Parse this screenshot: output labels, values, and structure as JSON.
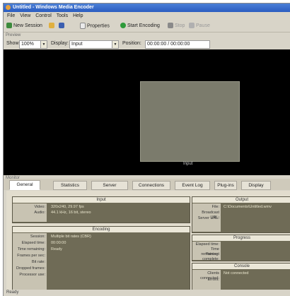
{
  "window": {
    "title": "Untitled - Windows Media Encoder"
  },
  "menu": [
    "File",
    "View",
    "Control",
    "Tools",
    "Help"
  ],
  "toolbar": {
    "new_session": "New Session",
    "properties": "Properties",
    "start_encoding": "Start Encoding",
    "stop": "Stop",
    "pause": "Pause"
  },
  "sections": {
    "preview": "Preview",
    "monitor": "Monitor"
  },
  "source_bar": {
    "show_label": "Show:",
    "show_value": "100%",
    "display_label": "Display:",
    "display_value": "Input",
    "position_label": "Position:",
    "position_value": "00:00:00 / 00:00:00"
  },
  "preview": {
    "label": "Input"
  },
  "tabs": [
    "General",
    "Statistics",
    "Server",
    "Connections",
    "Event Log",
    "Plug-ins",
    "Display"
  ],
  "groups": {
    "input": {
      "title": "Input",
      "labels": [
        "Video:",
        "Audio:"
      ],
      "values": [
        "320x240, 29.97 fps",
        "44.1 kHz, 16 bit, stereo"
      ]
    },
    "output": {
      "title": "Output",
      "labels": [
        "File:",
        "Broadcast URL:",
        "Server URL:"
      ],
      "values": [
        "C:\\Documents\\Untitled.wmv",
        "",
        ""
      ]
    },
    "encoding": {
      "title": "Encoding",
      "labels": [
        "Session:",
        "Elapsed time:",
        "Time remaining:",
        "Frames per sec:",
        "Bit rate:",
        "Dropped frames:",
        "Processor use:"
      ],
      "values": [
        "Multiple bit rates (CBR)",
        "00:00:00",
        "Ready",
        "",
        "",
        "",
        ""
      ]
    },
    "progress": {
      "title": "Progress",
      "labels": [
        "Elapsed time:",
        "Time remaining:",
        "Percent complete:"
      ],
      "values": [
        "",
        "",
        ""
      ]
    },
    "console": {
      "title": "Console",
      "labels": [
        "Clients connected:",
        "Errors:"
      ],
      "values": [
        "Not connected",
        ""
      ]
    }
  },
  "status": {
    "text": "Ready"
  },
  "colors": {
    "titlebar": "#2a5cc0",
    "preview_bg": "#000000",
    "group_bg": "#6f6b56",
    "screen": "#7b7b6c"
  }
}
